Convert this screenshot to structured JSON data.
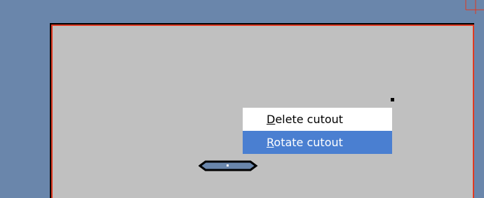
{
  "colors": {
    "background": "#6a86ab",
    "board_outline": "#e03a22",
    "board_fill": "#c0c0c0",
    "menu_highlight": "#4a7fd1",
    "cutout_fill": "#6a86ab"
  },
  "context_menu": {
    "items": [
      {
        "mnemonic": "D",
        "rest": "elete cutout",
        "selected": false
      },
      {
        "mnemonic": "R",
        "rest": "otate cutout",
        "selected": true
      }
    ]
  },
  "icons": [
    "corner-crosshair-icon",
    "slot-cutout-icon"
  ]
}
